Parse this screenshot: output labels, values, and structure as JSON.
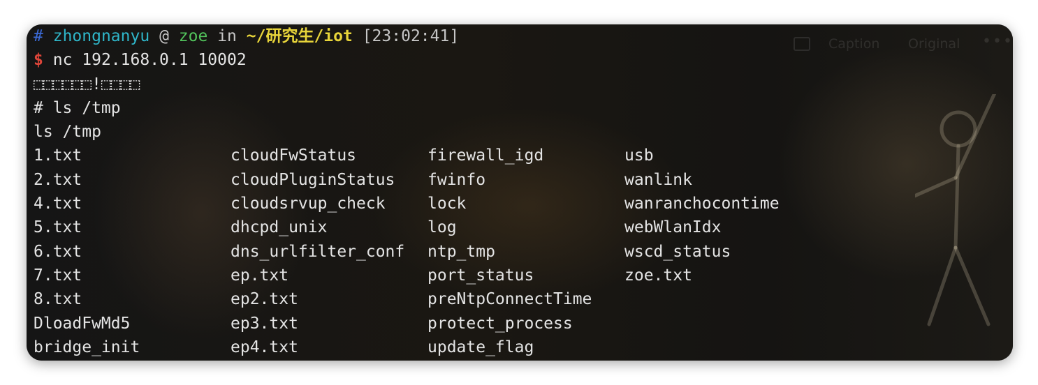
{
  "prompt": {
    "hash": "#",
    "user": "zhongnanyu",
    "at": "@",
    "host": "zoe",
    "in": "in",
    "path": "~/研究生/iot",
    "time": "[23:02:41]"
  },
  "command": {
    "dollar": "$",
    "text": "nc 192.168.0.1 10002"
  },
  "output_lines": [
    "⬚⬚⬚⬚⬚⬚!⬚⬚⬚⬚",
    "# ls /tmp",
    "ls /tmp"
  ],
  "listing_rows": [
    [
      "1.txt",
      "cloudFwStatus",
      "firewall_igd",
      "usb"
    ],
    [
      "2.txt",
      "cloudPluginStatus",
      "fwinfo",
      "wanlink"
    ],
    [
      "4.txt",
      "cloudsrvup_check",
      "lock",
      "wanranchocontime"
    ],
    [
      "5.txt",
      "dhcpd_unix",
      "log",
      "webWlanIdx"
    ],
    [
      "6.txt",
      "dns_urlfilter_conf",
      "ntp_tmp",
      "wscd_status"
    ],
    [
      "7.txt",
      "ep.txt",
      "port_status",
      "zoe.txt"
    ],
    [
      "8.txt",
      "ep2.txt",
      "preNtpConnectTime",
      ""
    ],
    [
      "DloadFwMd5",
      "ep3.txt",
      "protect_process",
      ""
    ],
    [
      "bridge_init",
      "ep4.txt",
      "update_flag",
      ""
    ]
  ],
  "overlay": {
    "caption": "Caption",
    "original": "Original",
    "more": "•••"
  },
  "colors": {
    "background": "#121212",
    "text": "#e4e4e4",
    "hash": "#3c6bd8",
    "user": "#2fb6c9",
    "host": "#52c45c",
    "path": "#e7d43a",
    "dollar": "#e0463a"
  }
}
